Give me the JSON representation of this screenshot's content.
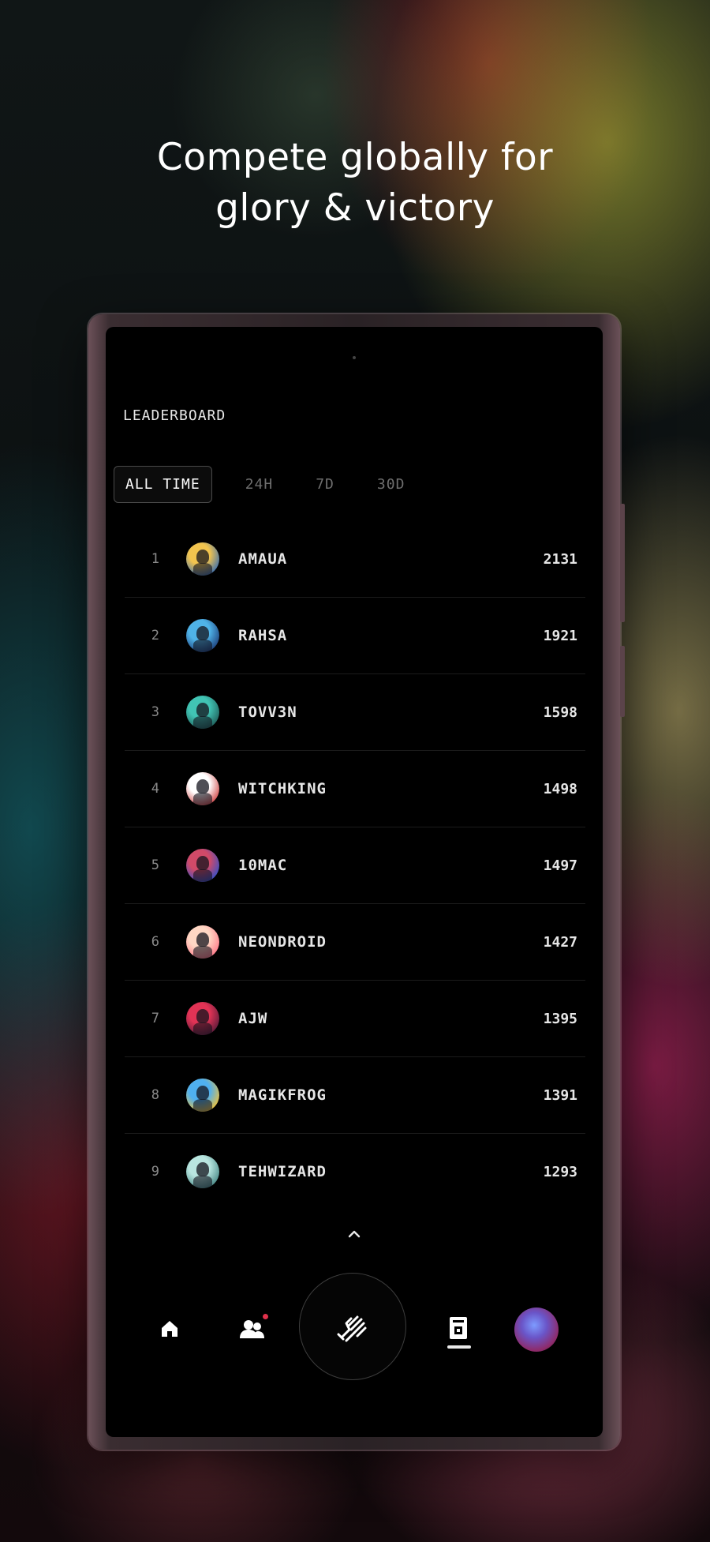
{
  "headline": {
    "line1": "Compete globally for",
    "line2": "glory & victory"
  },
  "leaderboard": {
    "title": "LEADERBOARD",
    "tabs": [
      {
        "label": "ALL TIME",
        "active": true
      },
      {
        "label": "24H",
        "active": false
      },
      {
        "label": "7D",
        "active": false
      },
      {
        "label": "30D",
        "active": false
      }
    ],
    "rows": [
      {
        "rank": "1",
        "name": "AMAUA",
        "score": "2131",
        "avatar_colors": [
          "#f2c44e",
          "#3b6fb0"
        ]
      },
      {
        "rank": "2",
        "name": "RAHSA",
        "score": "1921",
        "avatar_colors": [
          "#4fb3e8",
          "#1d3f7a"
        ]
      },
      {
        "rank": "3",
        "name": "TOVV3N",
        "score": "1598",
        "avatar_colors": [
          "#41c4b4",
          "#1f5f5a"
        ]
      },
      {
        "rank": "4",
        "name": "WITCHKING",
        "score": "1498",
        "avatar_colors": [
          "#ffffff",
          "#d04848"
        ]
      },
      {
        "rank": "5",
        "name": "10MAC",
        "score": "1497",
        "avatar_colors": [
          "#d14a68",
          "#3550c8"
        ]
      },
      {
        "rank": "6",
        "name": "NEONDROID",
        "score": "1427",
        "avatar_colors": [
          "#ffd7c4",
          "#ff7a8a"
        ]
      },
      {
        "rank": "7",
        "name": "AJW",
        "score": "1395",
        "avatar_colors": [
          "#e23355",
          "#5a1b3a"
        ]
      },
      {
        "rank": "8",
        "name": "MAGIKFROG",
        "score": "1391",
        "avatar_colors": [
          "#4fb0f0",
          "#f0c23a"
        ]
      },
      {
        "rank": "9",
        "name": "TEHWIZARD",
        "score": "1293",
        "avatar_colors": [
          "#b9e6e0",
          "#4a8a88"
        ]
      }
    ]
  },
  "nav": {
    "items": [
      "home-icon",
      "friends-icon",
      "play-hand-icon",
      "leaderboard-icon",
      "profile-avatar"
    ],
    "active": "leaderboard-icon",
    "notification_color": "#e0314b"
  }
}
